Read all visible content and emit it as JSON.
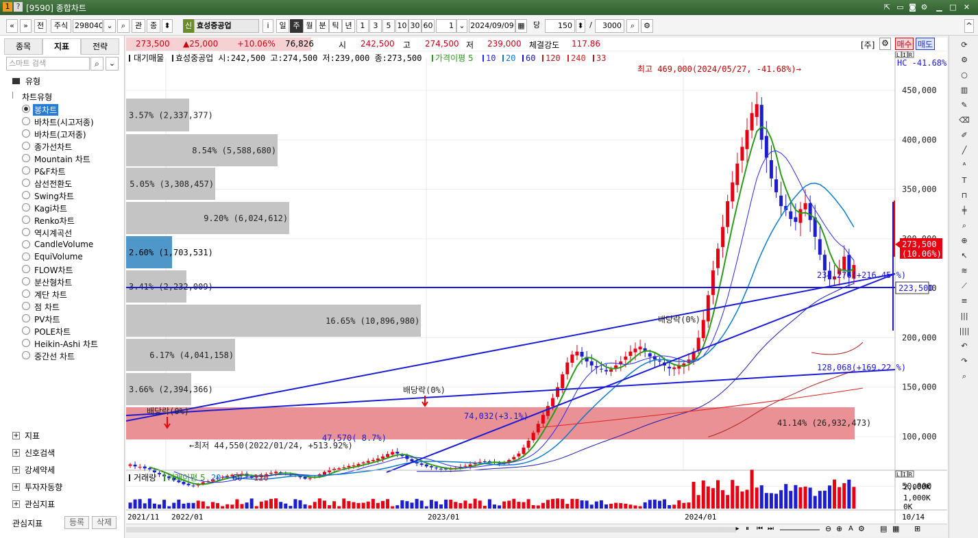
{
  "window": {
    "title": "[9590] 종합차트",
    "icons": [
      "menu-icon",
      "help-icon",
      "pin-icon",
      "restore-icon",
      "camera-icon",
      "settings-icon",
      "minimize-icon",
      "maximize-icon",
      "close-icon"
    ]
  },
  "toolbar": {
    "stock_type": "주식",
    "code": "298040",
    "fav": "관",
    "filter": "종",
    "badge": "신",
    "name": "효성중공업",
    "info": "i",
    "periods": [
      "일",
      "주",
      "월",
      "분",
      "틱",
      "년"
    ],
    "active_period": "주",
    "intervals": [
      "1",
      "3",
      "5",
      "10",
      "30",
      "60"
    ],
    "interval_value": "1",
    "date": "2024/09/09",
    "count_label": "당",
    "count": "150",
    "max": "3000"
  },
  "left": {
    "tabs": [
      "종목",
      "지표",
      "전략"
    ],
    "active_tab": "지표",
    "search_placeholder": "스마트 검색",
    "section": "유형",
    "group": "차트유형",
    "selected": "봉차트",
    "types": [
      "봉차트",
      "바차트(시고저종)",
      "바차트(고저종)",
      "종가선차트",
      "Mountain 차트",
      "P&F차트",
      "삼선전환도",
      "Swing차트",
      "Kagi차트",
      "Renko차트",
      "역시계곡선",
      "CandleVolume",
      "EquiVolume",
      "FLOW차트",
      "분산형차트",
      "계단 차트",
      "점 차트",
      "PV차트",
      "POLE차트",
      "Heikin-Ashi 차트",
      "중간선 차트"
    ],
    "sections": [
      "지표",
      "신호검색",
      "강세약세",
      "투자자동향",
      "관심지표"
    ],
    "bottom_label": "관심지표",
    "register": "등록",
    "delete": "삭제"
  },
  "quote": {
    "price": "273,500",
    "change": "▲25,000",
    "pct": "+10.06%",
    "volume": "76,826",
    "open_label": "시",
    "open": "242,500",
    "high_label": "고",
    "high": "274,500",
    "low_label": "저",
    "low": "239,000",
    "str_label": "체결강도",
    "strength": "117.86",
    "unit": "[주]",
    "buy": "매수",
    "sell": "매도"
  },
  "legend": {
    "prefix": "대기매물",
    "ohlc": "효성중공업 시:242,500 고:274,500 저:239,000 종:273,500",
    "ma_label": "가격이평",
    "ma": [
      "5",
      "10",
      "20",
      "60",
      "120",
      "240",
      "33"
    ],
    "ma_colors": [
      "#2a9a18",
      "#2626ff",
      "#0a7ad0",
      "#1a1ab0",
      "#b02020",
      "#e02020",
      "#b02020"
    ]
  },
  "colors": {
    "up": "#e60012",
    "down": "#1c1cd0",
    "profile": "#c4c4c4",
    "profile_hl": "#4f97c9",
    "band": "#e88b8e",
    "trend": "#1a1ad6",
    "level": "#1a1ad6"
  },
  "chart_data": {
    "type": "candlestick",
    "title": "효성중공업 주봉",
    "y_axis": [
      "450,000",
      "400,000",
      "350,000",
      "300,000",
      "250,000",
      "200,000",
      "150,000",
      "100,000",
      "50,000"
    ],
    "x_axis": [
      "2021/11",
      "2022/01",
      "2023/01",
      "2024/01",
      "10/14"
    ],
    "profile": [
      {
        "price": 455000,
        "label": "3.57% (2,337,377)",
        "pct": 3.57
      },
      {
        "price": 415000,
        "label": "8.54% (5,588,680)",
        "pct": 8.54
      },
      {
        "price": 375000,
        "label": "5.05% (3,308,457)",
        "pct": 5.05
      },
      {
        "price": 335000,
        "label": "9.20% (6,024,612)",
        "pct": 9.2
      },
      {
        "price": 295000,
        "label": "2.60% (1,703,531)",
        "pct": 2.6,
        "current": true
      },
      {
        "price": 255000,
        "label": "3.41% (2,232,009)",
        "pct": 3.41
      },
      {
        "price": 215000,
        "label": "16.65% (10,896,980)",
        "pct": 16.65
      },
      {
        "price": 175000,
        "label": "6.17% (4,041,158)",
        "pct": 6.17
      },
      {
        "price": 135000,
        "label": "3.66% (2,394,366)",
        "pct": 3.66
      },
      {
        "price": 75000,
        "label": "41.14% (26,932,473)",
        "pct": 41.14
      }
    ],
    "annotations": {
      "high": "최고 469,000(2024/05/27, -41.68%)→",
      "low": "←최저 44,550(2022/01/24, +513.92%)",
      "div1": "배당락(0%)",
      "div2": "배당락(0%)",
      "div3": "배당락(0%)",
      "trend1": "234,276(+216.45 %)",
      "trend2": "128,068(+169.22 %)",
      "trend3": "47,570(  8.7%)",
      "trend4": "74,032(+3.1%)",
      "hc": "HC -41.68%",
      "price_tag": "273,500",
      "price_pct": "(10.06%)",
      "level": "223,500"
    },
    "level_value": 223500
  },
  "volume": {
    "label": "거래량",
    "ma_label": "거래이평",
    "ma": [
      "5",
      "20",
      "60",
      "120"
    ],
    "ticks": [
      "2,000K",
      "1,000K",
      "0K"
    ]
  }
}
